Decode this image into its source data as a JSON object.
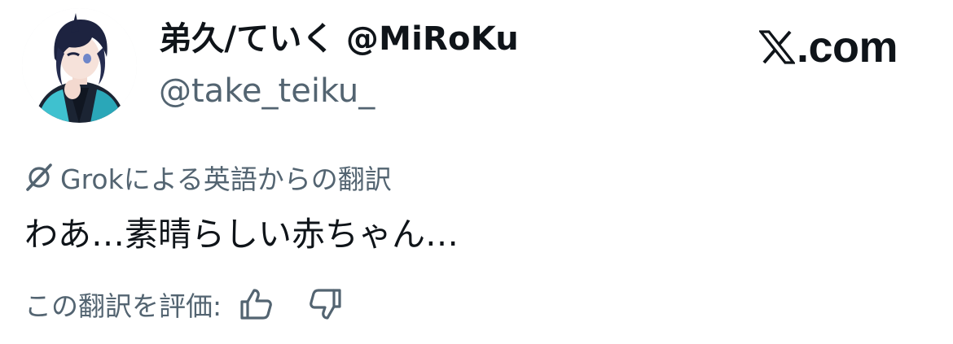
{
  "author": {
    "display_name": "弟久/ていく @MiRoKu",
    "handle": "@take_teiku_",
    "avatar_icon": "anime-character-avatar"
  },
  "brand": {
    "icon": "x-logo-icon",
    "text": ".com"
  },
  "translation": {
    "icon": "grok-icon",
    "label": "Grokによる英語からの翻訳",
    "text": "わあ…素晴らしい赤ちゃん…"
  },
  "rating": {
    "label": "この翻訳を評価:",
    "like_icon": "thumbs-up-icon",
    "dislike_icon": "thumbs-down-icon"
  },
  "colors": {
    "text_primary": "#0f1419",
    "text_secondary": "#536471",
    "background": "#ffffff"
  }
}
